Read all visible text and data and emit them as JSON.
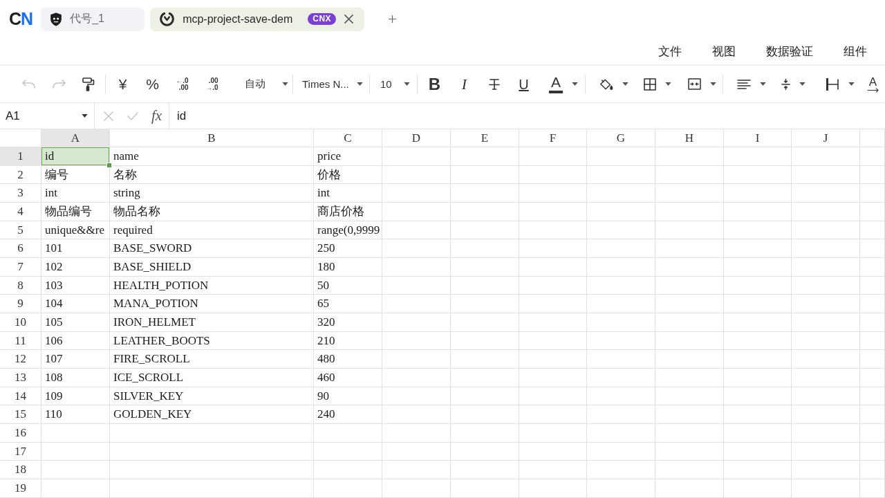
{
  "app": {
    "logo": "CN"
  },
  "tabs": [
    {
      "label": "代号_1",
      "selected": false
    },
    {
      "label": "mcp-project-save-dem",
      "badge": "CNX",
      "selected": true
    }
  ],
  "menu": [
    {
      "label": "文件"
    },
    {
      "label": "视图"
    },
    {
      "label": "数据验证"
    },
    {
      "label": "组件"
    }
  ],
  "toolbar": [
    {
      "kind": "icon",
      "disabled": true
    },
    {
      "kind": "icon",
      "disabled": true
    },
    {
      "kind": "icon",
      "disabled": false
    },
    {
      "kind": "separator"
    },
    {
      "kind": "glyph",
      "text": "¥",
      "disabled": false
    },
    {
      "kind": "glyph",
      "text": "%",
      "disabled": false
    },
    {
      "kind": "stacked",
      "lines": [
        "←.0",
        ".00"
      ],
      "disabled": false
    },
    {
      "kind": "stacked",
      "lines": [
        ".00",
        "→.0"
      ],
      "disabled": false
    },
    {
      "kind": "select",
      "text": "自动",
      "disabled": false
    },
    {
      "kind": "separator"
    },
    {
      "kind": "select",
      "text": "Times N...",
      "disabled": false
    },
    {
      "kind": "separator"
    },
    {
      "kind": "select",
      "text": "10",
      "disabled": false
    },
    {
      "kind": "separator"
    },
    {
      "kind": "glyph",
      "text": "B",
      "disabled": false
    },
    {
      "kind": "glyph",
      "text": "I",
      "disabled": false
    },
    {
      "kind": "icon",
      "disabled": false
    },
    {
      "kind": "glyph",
      "text": "U",
      "disabled": false
    },
    {
      "kind": "glyph-menu",
      "text": "A",
      "disabled": false
    },
    {
      "kind": "separator"
    },
    {
      "kind": "icon-menu",
      "disabled": false
    },
    {
      "kind": "icon-menu",
      "disabled": false
    },
    {
      "kind": "icon-menu",
      "disabled": false
    },
    {
      "kind": "separator"
    },
    {
      "kind": "icon-menu",
      "disabled": false
    },
    {
      "kind": "icon-menu",
      "disabled": false
    },
    {
      "kind": "icon-menu",
      "disabled": false
    },
    {
      "kind": "glyph",
      "text": "A",
      "disabled": false
    }
  ],
  "formula_bar": {
    "cell_reference": "A1",
    "actions": [
      {
        "disabled": true
      },
      {
        "disabled": true
      }
    ],
    "function_label": "fx",
    "formula": "id"
  },
  "sheet": {
    "columns": [
      {
        "label": "A",
        "selected": true
      },
      {
        "label": "B",
        "selected": false
      },
      {
        "label": "C",
        "selected": false
      },
      {
        "label": "D",
        "selected": false
      },
      {
        "label": "E",
        "selected": false
      },
      {
        "label": "F",
        "selected": false
      },
      {
        "label": "G",
        "selected": false
      },
      {
        "label": "H",
        "selected": false
      },
      {
        "label": "I",
        "selected": false
      },
      {
        "label": "J",
        "selected": false
      }
    ],
    "rows": [
      {
        "label": "1",
        "selected": true,
        "cells": [
          "id",
          "name",
          "price"
        ]
      },
      {
        "label": "2",
        "selected": false,
        "cells": [
          "编号",
          "名称",
          "价格"
        ]
      },
      {
        "label": "3",
        "selected": false,
        "cells": [
          "int",
          "string",
          "int"
        ]
      },
      {
        "label": "4",
        "selected": false,
        "cells": [
          "物品编号",
          "物品名称",
          "商店价格"
        ]
      },
      {
        "label": "5",
        "selected": false,
        "cells": [
          "unique&&re",
          "required",
          "range(0,9999"
        ]
      },
      {
        "label": "6",
        "selected": false,
        "cells": [
          "101",
          "BASE_SWORD",
          "250"
        ]
      },
      {
        "label": "7",
        "selected": false,
        "cells": [
          "102",
          "BASE_SHIELD",
          "180"
        ]
      },
      {
        "label": "8",
        "selected": false,
        "cells": [
          "103",
          "HEALTH_POTION",
          "50"
        ]
      },
      {
        "label": "9",
        "selected": false,
        "cells": [
          "104",
          "MANA_POTION",
          "65"
        ]
      },
      {
        "label": "10",
        "selected": false,
        "cells": [
          "105",
          "IRON_HELMET",
          "320"
        ]
      },
      {
        "label": "11",
        "selected": false,
        "cells": [
          "106",
          "LEATHER_BOOTS",
          "210"
        ]
      },
      {
        "label": "12",
        "selected": false,
        "cells": [
          "107",
          "FIRE_SCROLL",
          "480"
        ]
      },
      {
        "label": "13",
        "selected": false,
        "cells": [
          "108",
          "ICE_SCROLL",
          "460"
        ]
      },
      {
        "label": "14",
        "selected": false,
        "cells": [
          "109",
          "SILVER_KEY",
          "90"
        ]
      },
      {
        "label": "15",
        "selected": false,
        "cells": [
          "110",
          "GOLDEN_KEY",
          "240"
        ]
      },
      {
        "label": "16",
        "selected": false
      },
      {
        "label": "17",
        "selected": false
      },
      {
        "label": "18",
        "selected": false
      },
      {
        "label": "19",
        "selected": false
      }
    ]
  }
}
